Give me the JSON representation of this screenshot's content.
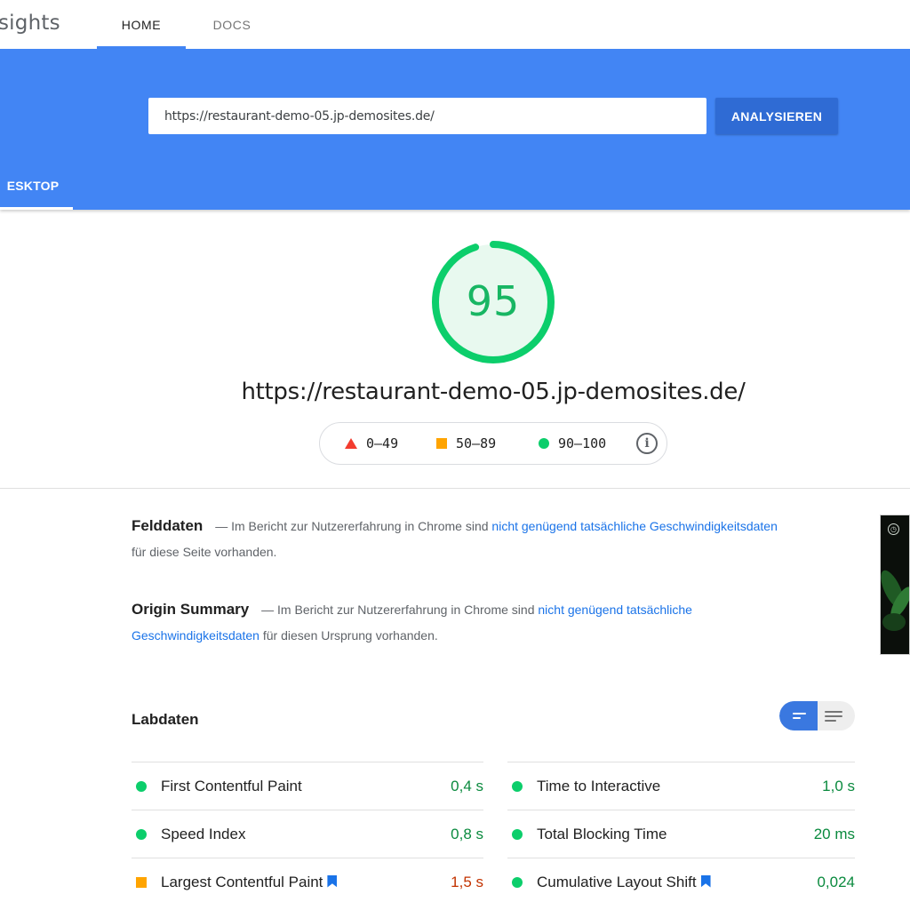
{
  "app": {
    "brand": "sights"
  },
  "nav": {
    "tabs": [
      {
        "label": "HOME"
      },
      {
        "label": "DOCS"
      }
    ]
  },
  "search": {
    "value": "https://restaurant-demo-05.jp-demosites.de/",
    "button_label": "ANALYSIEREN"
  },
  "device_tab": {
    "label": "ESKTOP"
  },
  "score": {
    "value": "95",
    "fraction": 0.95,
    "color": "#0cce6b"
  },
  "page_url": "https://restaurant-demo-05.jp-demosites.de/",
  "legend": {
    "items": [
      {
        "label": "0–49",
        "shape": "triangle",
        "color": "#f33c2f"
      },
      {
        "label": "50–89",
        "shape": "square",
        "color": "#ffa400"
      },
      {
        "label": "90–100",
        "shape": "circle",
        "color": "#0cce6b"
      }
    ],
    "info_icon": "info-icon"
  },
  "field_data": {
    "title": "Felddaten",
    "pre": "— Im Bericht zur Nutzererfahrung in Chrome sind",
    "link": "nicht genügend tatsächliche Geschwindigkeitsdaten",
    "post": "für diese Seite vorhanden."
  },
  "origin_summary": {
    "title": "Origin Summary",
    "pre": "— Im Bericht zur Nutzererfahrung in Chrome sind",
    "link": "nicht genügend tatsächliche Geschwindigkeitsdaten",
    "post": "für diesen Ursprung vorhanden."
  },
  "lab_data": {
    "title": "Labdaten",
    "metrics_left": [
      {
        "label": "First Contentful Paint",
        "value": "0,4 s",
        "status": "good",
        "bookmark": false
      },
      {
        "label": "Speed Index",
        "value": "0,8 s",
        "status": "good",
        "bookmark": false
      },
      {
        "label": "Largest Contentful Paint",
        "value": "1,5 s",
        "status": "average",
        "bookmark": true
      }
    ],
    "metrics_right": [
      {
        "label": "Time to Interactive",
        "value": "1,0 s",
        "status": "good",
        "bookmark": false
      },
      {
        "label": "Total Blocking Time",
        "value": "20 ms",
        "status": "good",
        "bookmark": false
      },
      {
        "label": "Cumulative Layout Shift",
        "value": "0,024",
        "status": "good",
        "bookmark": true
      }
    ]
  }
}
